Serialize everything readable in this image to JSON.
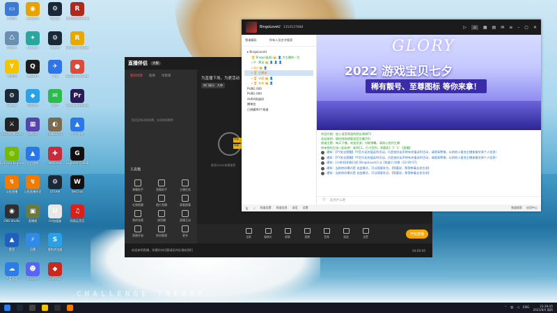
{
  "desktop": {
    "watermark": "CHALLENGE THEORY",
    "icons": [
      {
        "label": "此电脑",
        "glyph": "▭",
        "color": "#3c7ad6"
      },
      {
        "label": "wegame",
        "glyph": "◉",
        "color": "#e7a200"
      },
      {
        "label": "Steam",
        "glyph": "⚙",
        "color": "#1b2838"
      },
      {
        "label": "Red Dead Redemption",
        "glyph": "R",
        "color": "#b3271c"
      },
      {
        "label": "回收站",
        "glyph": "♺",
        "color": "#6a8fb3"
      },
      {
        "label": "Lantern",
        "glyph": "✦",
        "color": "#2aa6a0"
      },
      {
        "label": "Steam",
        "glyph": "⚙",
        "color": "#1b2838"
      },
      {
        "label": "Rockstar Games Launcher",
        "glyph": "R",
        "color": "#e8a800"
      },
      {
        "label": "YY语音",
        "glyph": "Y",
        "color": "#f5c400"
      },
      {
        "label": "腾讯QQ",
        "glyph": "Q",
        "color": "#1c1c1c"
      },
      {
        "label": "飞书",
        "glyph": "✈",
        "color": "#2f74e8"
      },
      {
        "label": "Google Chrome",
        "glyph": "●",
        "color": "#d94b3b"
      },
      {
        "label": "Steam",
        "glyph": "⚙",
        "color": "#1b2838"
      },
      {
        "label": "QQ游戏",
        "glyph": "◆",
        "color": "#2aa2e8"
      },
      {
        "label": "微信",
        "glyph": "✉",
        "color": "#2dbb4e"
      },
      {
        "label": "Adobe Premiere",
        "glyph": "Pr",
        "color": "#2a1a55"
      },
      {
        "label": "ROG ARMOURY",
        "glyph": "⚔",
        "color": "#222"
      },
      {
        "label": "GPU-Z",
        "glyph": "▦",
        "color": "#5544aa"
      },
      {
        "label": "PUBG LITE",
        "glyph": "◐",
        "color": "#7a6a50"
      },
      {
        "label": "小白游戏",
        "glyph": "▲",
        "color": "#2a78e8"
      },
      {
        "label": "GeForce Experience",
        "glyph": "◎",
        "color": "#76b900"
      },
      {
        "label": "小白游戏",
        "glyph": "▲",
        "color": "#2a78e8"
      },
      {
        "label": "WeGame",
        "glyph": "✚",
        "color": "#c92b3a"
      },
      {
        "label": "Logitech G HUB",
        "glyph": "G",
        "color": "#111"
      },
      {
        "label": "斗鱼直播",
        "glyph": "↯",
        "color": "#f07b00"
      },
      {
        "label": "斗鱼直播伴侣",
        "glyph": "↯",
        "color": "#f07b00"
      },
      {
        "label": "STEAM",
        "glyph": "⚙",
        "color": "#1b2838"
      },
      {
        "label": "WeChat",
        "glyph": "W",
        "color": "#111"
      },
      {
        "label": "OBS Studio",
        "glyph": "◉",
        "color": "#302e31"
      },
      {
        "label": "直播姬",
        "glyph": "▣",
        "color": "#6a7a40"
      },
      {
        "label": "UU加速器",
        "glyph": "U",
        "color": "#e8e8e8"
      },
      {
        "label": "网易云音乐",
        "glyph": "♫",
        "color": "#d8201c"
      },
      {
        "label": "傲游",
        "glyph": "▲",
        "color": "#1f5fbf"
      },
      {
        "label": "迅雷",
        "glyph": "⚡",
        "color": "#2f8ae8"
      },
      {
        "label": "搜狗浏览器",
        "glyph": "S",
        "color": "#2aa0e8"
      },
      {
        "label": "",
        "glyph": "",
        "color": "transparent"
      },
      {
        "label": "百度网盘",
        "glyph": "☁",
        "color": "#2c7de8"
      },
      {
        "label": "Discord",
        "glyph": "☻",
        "color": "#5865f2"
      },
      {
        "label": "Gamepp",
        "glyph": "◆",
        "color": "#c8281e"
      },
      {
        "label": "",
        "glyph": "",
        "color": "transparent"
      }
    ]
  },
  "zhibo": {
    "title": "直播伴侣",
    "version": "大版",
    "tabs": [
      "我的场景",
      "图库",
      "场景库"
    ],
    "empty_text": "您还没有添加场景，去添加场景吧",
    "hint": "为直播下场，为更活动",
    "chip": "热门娱乐 · 大神",
    "center_sub": "更多(Live)场景推荐",
    "scene1": "场景",
    "scene2": "场景",
    "tools_title": "工具箱",
    "tools": [
      "弹幕助手",
      "答题助手",
      "主播任务",
      "礼物提醒",
      "图片直播",
      "观看图看",
      "我的场景",
      "调用播",
      "直播互动",
      "直播开始",
      "房间管理",
      "更多"
    ],
    "bottom_buttons": [
      "全屏",
      "摄像头",
      "屏幕",
      "直播",
      "音频",
      "画面",
      "设置"
    ],
    "start_button": "开始直播",
    "status_text": "欢迎来到直播，如遇任何问题请及时反馈给我们",
    "status_right": "04:00:00"
  },
  "yy": {
    "username": "BingoLoveU",
    "user_id": "1354537888",
    "tabs": [
      "频道精彩",
      "所有人员名字搜索"
    ],
    "tree": [
      {
        "text": "▸ BingoLoveU",
        "cls": "ind1"
      },
      {
        "text": "🏆 Bingo(谁说) 👑 👤 大主播的一生",
        "cls": "ind2 grn"
      },
      {
        "text": "▹ 0 · 黄宝 👑 👤 👤 👤",
        "cls": "ind2 grn"
      },
      {
        "text": "▹ bin 👑 👤",
        "cls": "ind2 org"
      },
      {
        "text": "▹ 🏆 主播弟",
        "cls": "ind2 org sel"
      },
      {
        "text": "▹ 🏆 冰面 👑 👤",
        "cls": "ind2 org"
      },
      {
        "text": "▹ 🏆 东东 👑 👤",
        "cls": "ind2 org"
      },
      {
        "text": "PUBG 000",
        "cls": "ind1"
      },
      {
        "text": "PUBG 000",
        "cls": "ind1"
      },
      {
        "text": "AURA频道间",
        "cls": "ind1"
      },
      {
        "text": "播电台",
        "cls": "ind1"
      },
      {
        "text": "已隐藏90个频道",
        "cls": "ind1"
      }
    ],
    "banner": {
      "glory": "GLORY",
      "headline": "2022 游戏宝贝七夕",
      "sub": "稀有靓号、至尊图标 等你来拿！"
    },
    "chat_green": [
      "欢迎光临：加入语音频道的朋友请按F5",
      "欢迎来到：随时随地就跟语音可播(F6)",
      "频道主题：每天下播，欢迎交流，对刷弹幕，请耐心找到主播",
      "快来我的主场一起玩吧：新到11，打卡签到，享额奖1 '1' '1' 【直播】"
    ],
    "chat_rows": [
      "通知：【YY安全提醒】YY官方无充值返利活动。凡是加好友声称有充值返利活动，请提高警惕，以防他人冒充主播查看交易个人信息！",
      "通知：【YY安全提醒】YY官方无充值返利活动。凡是加好友声称有充值返利活动，请提高警惕，以防他人冒充主播查看交易个人信息！",
      "通知：[小房间]如图已经 [BingoLoveU] 从 [频道1] 切换（22:09:57）",
      "通知：当前房间模式是 自由模式，可以随意发言。【我要说，那我带着去发言说】",
      "通知：当前房间模式是 自由模式，可以随意发言。【我要说，那我带着去发言说】"
    ],
    "input_placeholder": "说点什么吧",
    "bottom_items": [
      "频道设置",
      "频道信息",
      "录音",
      "设置"
    ],
    "bottom_right": [
      "频道搜索",
      "应用中心"
    ]
  },
  "taskbar": {
    "tray_lang": "ENG",
    "time": "23:39:45",
    "date": "2022/8/4 周四"
  }
}
